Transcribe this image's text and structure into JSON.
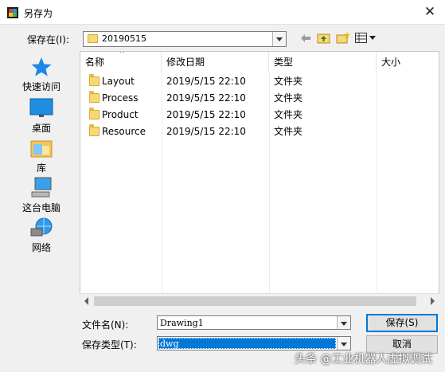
{
  "window": {
    "title": "另存为",
    "close_glyph": "✕"
  },
  "save_in": {
    "label": "保存在(I):",
    "value": "20190515"
  },
  "toolbar": {
    "icons": [
      "back-arrow-icon",
      "up-folder-icon",
      "new-folder-icon",
      "view-menu-icon"
    ]
  },
  "places": [
    {
      "label": "快速访问",
      "icon": "star-icon"
    },
    {
      "label": "桌面",
      "icon": "desktop-icon"
    },
    {
      "label": "库",
      "icon": "library-icon"
    },
    {
      "label": "这台电脑",
      "icon": "computer-icon"
    },
    {
      "label": "网络",
      "icon": "network-icon"
    }
  ],
  "columns": {
    "name": "名称",
    "modified": "修改日期",
    "type": "类型",
    "size": "大小"
  },
  "files": [
    {
      "name": "Layout",
      "modified": "2019/5/15 22:10",
      "type": "文件夹",
      "size": ""
    },
    {
      "name": "Process",
      "modified": "2019/5/15 22:10",
      "type": "文件夹",
      "size": ""
    },
    {
      "name": "Product",
      "modified": "2019/5/15 22:10",
      "type": "文件夹",
      "size": ""
    },
    {
      "name": "Resource",
      "modified": "2019/5/15 22:10",
      "type": "文件夹",
      "size": ""
    }
  ],
  "filename": {
    "label": "文件名(N):",
    "value": "Drawing1"
  },
  "filetype": {
    "label": "保存类型(T):",
    "value": "dwg"
  },
  "buttons": {
    "save": "保存(S)",
    "cancel": "取消"
  },
  "watermark": "头条 @工业机器人虚拟调试",
  "colors": {
    "accent": "#0078d7",
    "folder": "#f8d775",
    "selection": "#0078d7"
  }
}
